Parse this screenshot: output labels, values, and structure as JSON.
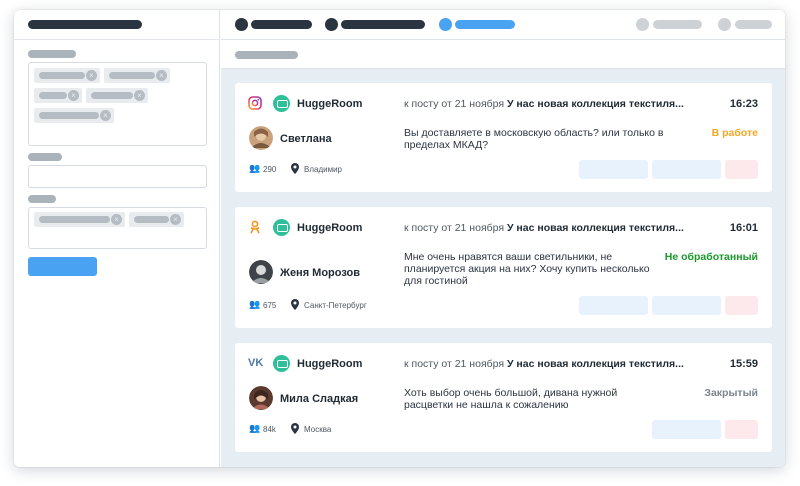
{
  "colors": {
    "accent": "#4aa3f2",
    "status_in_progress": "#f5a623",
    "status_unprocessed": "#1a9a2a",
    "status_closed": "#7b848c"
  },
  "cards": [
    {
      "network_icon": "instagram-icon",
      "brand": "HuggeRoom",
      "post_ref": "к посту от 21 ноября",
      "post_title": "У нас новая коллекция текстиля...",
      "time": "16:23",
      "user": "Светлана",
      "avatar_icon": "user-avatar",
      "message": "Вы доставляете в московскую область? или только в пределах МКАД?",
      "status": "В работе",
      "followers": "290",
      "city": "Владимир"
    },
    {
      "network_icon": "odnoklassniki-icon",
      "brand": "HuggeRoom",
      "post_ref": "к посту от 21 ноября",
      "post_title": "У нас новая коллекция текстиля...",
      "time": "16:01",
      "user": "Женя Морозов",
      "avatar_icon": "user-avatar",
      "message": "Мне очень нравятся ваши светильники, не планируется акция на них? Хочу купить несколько для гостиной",
      "status": "Не обработанный",
      "followers": "675",
      "city": "Санкт-Петербург"
    },
    {
      "network_icon": "vk-icon",
      "brand": "HuggeRoom",
      "post_ref": "к посту от 21 ноября",
      "post_title": "У нас новая коллекция текстиля...",
      "time": "15:59",
      "user": "Мила Сладкая",
      "avatar_icon": "user-avatar",
      "message": "Хоть выбор очень большой, дивана нужной расцветки не нашла к сожалению",
      "status": "Закрытый",
      "followers": "84k",
      "city": "Москва"
    }
  ]
}
